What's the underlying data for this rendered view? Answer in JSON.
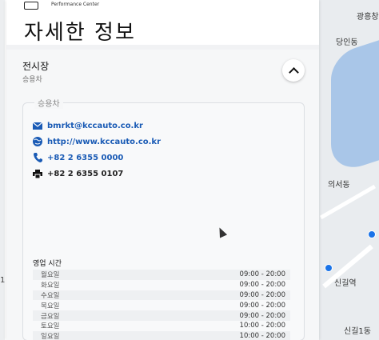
{
  "header": {
    "logo_text": "Performance Center",
    "title": "자세한 정보"
  },
  "section": {
    "title": "전시장",
    "subtitle": "승용차",
    "toggle_icon": "chevron-up-icon"
  },
  "card": {
    "legend": "승용차",
    "email": "bmrkt@kccauto.co.kr",
    "website": "http://www.kccauto.co.kr",
    "phone": "+82 2 6355 0000",
    "fax": "+82 2 6355 0107"
  },
  "hours": {
    "title": "영업 시간",
    "rows": [
      {
        "day": "월요일",
        "time": "09:00 - 20:00"
      },
      {
        "day": "화요일",
        "time": "09:00 - 20:00"
      },
      {
        "day": "수요일",
        "time": "09:00 - 20:00"
      },
      {
        "day": "목요일",
        "time": "09:00 - 20:00"
      },
      {
        "day": "금요일",
        "time": "09:00 - 20:00"
      },
      {
        "day": "토요일",
        "time": "10:00 - 20:00"
      },
      {
        "day": "일요일",
        "time": "10:00 - 20:00"
      }
    ]
  },
  "map": {
    "labels": [
      "광흥창",
      "당인동",
      "의서동",
      "신길역",
      "신길1동"
    ],
    "left_edge_text": "1"
  },
  "colors": {
    "link": "#1a5bb5",
    "water": "#a9c6e8"
  }
}
